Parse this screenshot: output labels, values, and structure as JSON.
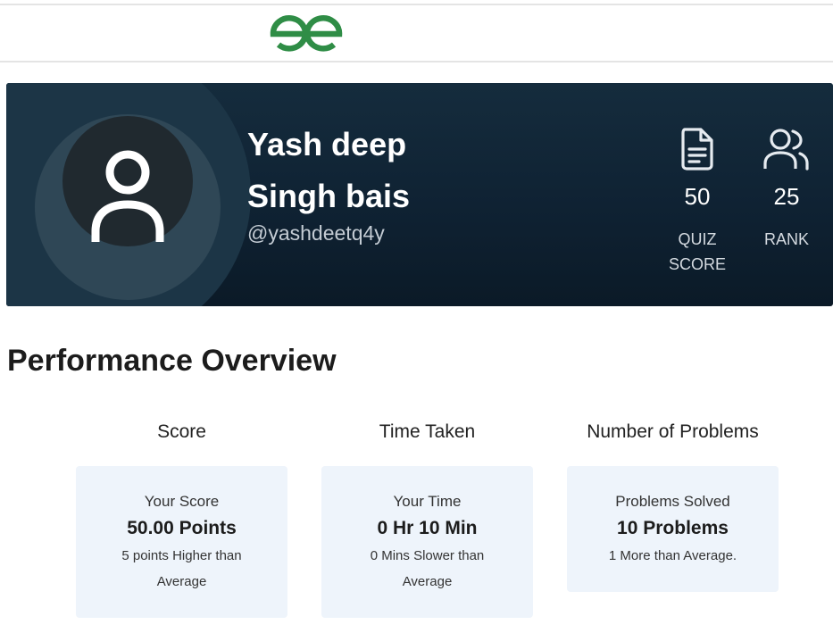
{
  "header": {
    "logo_icon": "geeksforgeeks-logo-icon",
    "brand_color": "#2f8d46"
  },
  "profile": {
    "avatar_icon": "user-avatar-icon",
    "name": "Yash deep Singh bais",
    "username": "@yashdeetq4y",
    "stats": {
      "quiz_score": {
        "icon": "document-icon",
        "value": "50",
        "label": "QUIZ SCORE"
      },
      "rank": {
        "icon": "users-icon",
        "value": "25",
        "label": "RANK"
      }
    }
  },
  "performance": {
    "title": "Performance Overview",
    "cards": {
      "score": {
        "heading": "Score",
        "label": "Your Score",
        "value": "50.00 Points",
        "note": "5 points Higher than Average"
      },
      "time": {
        "heading": "Time Taken",
        "label": "Your Time",
        "value": "0 Hr 10 Min",
        "note": "0 Mins Slower than Average"
      },
      "problems": {
        "heading": "Number of Problems",
        "label": "Problems Solved",
        "value": "10 Problems",
        "note": "1 More than Average."
      }
    }
  }
}
